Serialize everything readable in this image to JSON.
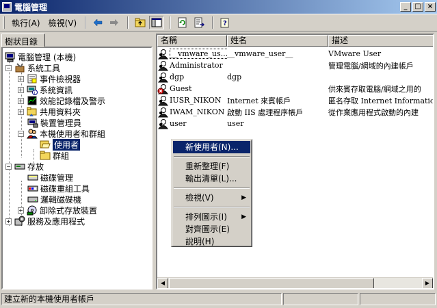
{
  "window": {
    "title": "電腦管理"
  },
  "toolbar": {
    "action_label": "執行(A)",
    "view_label": "檢視(V)"
  },
  "left_tab": {
    "label": "樹狀目錄"
  },
  "tree": [
    {
      "label": "電腦管理 (本機)"
    },
    {
      "label": "系統工具"
    },
    {
      "label": "事件檢視器"
    },
    {
      "label": "系統資訊"
    },
    {
      "label": "效能記錄檔及警示"
    },
    {
      "label": "共用資料夾"
    },
    {
      "label": "裝置管理員"
    },
    {
      "label": "本機使用者和群組"
    },
    {
      "label": "使用者"
    },
    {
      "label": "群組"
    },
    {
      "label": "存放"
    },
    {
      "label": "磁碟管理"
    },
    {
      "label": "磁碟重組工具"
    },
    {
      "label": "邏輯磁碟機"
    },
    {
      "label": "卸除式存放裝置"
    },
    {
      "label": "服務及應用程式"
    }
  ],
  "list": {
    "columns": [
      "名稱",
      "姓名",
      "描述"
    ],
    "rows": [
      {
        "name": "__vmware_us...",
        "fullname": "__vmware_user__",
        "desc": "VMware User"
      },
      {
        "name": "Administrator",
        "fullname": "",
        "desc": "管理電腦/網域的內建帳戶"
      },
      {
        "name": "dgp",
        "fullname": "dgp",
        "desc": ""
      },
      {
        "name": "Guest",
        "fullname": "",
        "desc": "供來賓存取電腦/網域之用的"
      },
      {
        "name": "IUSR_NIKON",
        "fullname": "Internet 來賓帳戶",
        "desc": "匿名存取 Internet Information"
      },
      {
        "name": "IWAM_NIKON",
        "fullname": "啟動 IIS 處理程序帳戶",
        "desc": "從作業應用程式啟動的內建"
      },
      {
        "name": "user",
        "fullname": "user",
        "desc": ""
      }
    ]
  },
  "context_menu": {
    "new_user": "新使用者(N)...",
    "refresh": "重新整理(F)",
    "export": "輸出清單(L)...",
    "view": "檢視(V)",
    "arrange": "排列圖示(I)",
    "lineup": "對齊圖示(E)",
    "help": "說明(H)"
  },
  "status": {
    "text": "建立新的本機使用者帳戶"
  }
}
